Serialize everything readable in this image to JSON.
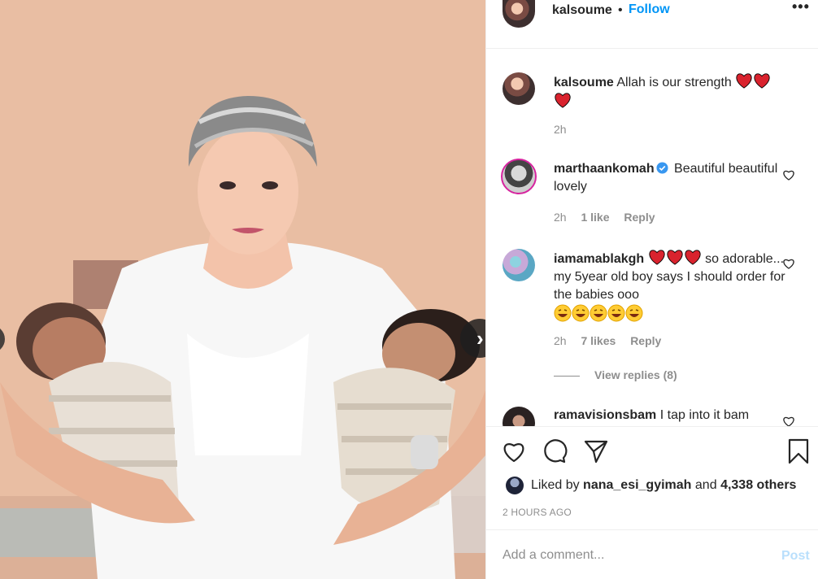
{
  "header": {
    "username": "kalsoume",
    "separator": "•",
    "follow_label": "Follow",
    "more_icon": "more-options-icon",
    "more_label": "•••"
  },
  "comments": [
    {
      "username": "kalsoume",
      "text": "Allah is our strength",
      "emoji": [
        "heart",
        "heart",
        "heart"
      ],
      "time": "2h"
    },
    {
      "username": "marthaankomah",
      "verified": true,
      "text": "Beautiful beautiful lovely",
      "time": "2h",
      "likes": "1 like",
      "reply_label": "Reply"
    },
    {
      "username": "iamamablakgh",
      "text_after_emoji": "so adorable... my 5year old boy says I should order for the babies ooo",
      "emoji": [
        "heart",
        "heart",
        "heart",
        "grin",
        "grin",
        "grin",
        "grin",
        "grin"
      ],
      "time": "2h",
      "likes": "7 likes",
      "reply_label": "Reply",
      "view_replies": "View replies (8)"
    },
    {
      "username": "ramavisionsbam",
      "text": "I tap into it bam"
    }
  ],
  "actions": {
    "like_icon": "heart-icon",
    "comment_icon": "comment-icon",
    "share_icon": "share-icon",
    "save_icon": "bookmark-icon"
  },
  "likes": {
    "prefix": "Liked by",
    "user": "nana_esi_gyimah",
    "connector": "and",
    "others": "4,338 others"
  },
  "timestamp": "2 HOURS AGO",
  "add_comment": {
    "placeholder": "Add a comment...",
    "post_label": "Post"
  },
  "colors": {
    "accent": "#0095f6",
    "post_disabled": "#b9dffc",
    "heart": "#ed4956",
    "muted": "#8e8e8e"
  }
}
